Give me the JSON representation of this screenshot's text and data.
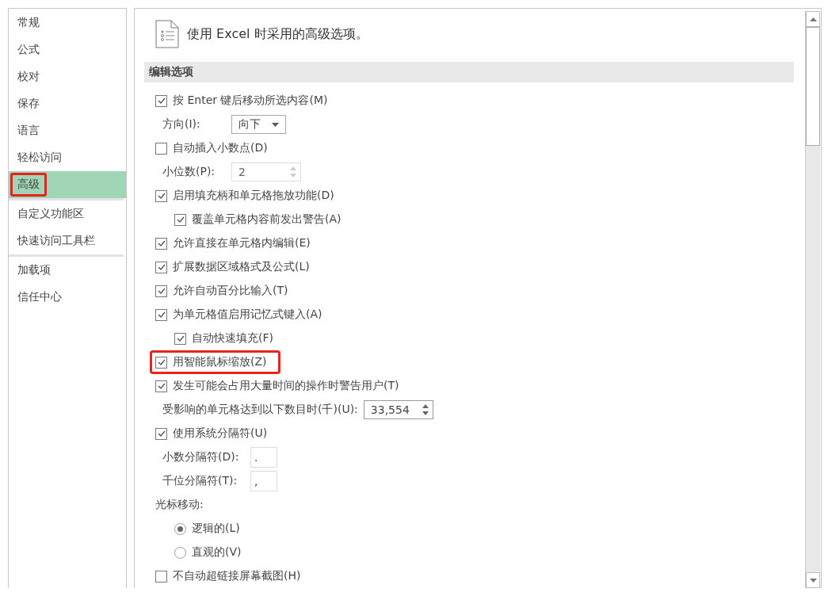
{
  "sidebar": {
    "groups": [
      [
        {
          "label": "常规",
          "selected": false,
          "highlighted": false
        },
        {
          "label": "公式",
          "selected": false,
          "highlighted": false
        },
        {
          "label": "校对",
          "selected": false,
          "highlighted": false
        },
        {
          "label": "保存",
          "selected": false,
          "highlighted": false
        },
        {
          "label": "语言",
          "selected": false,
          "highlighted": false
        },
        {
          "label": "轻松访问",
          "selected": false,
          "highlighted": false
        },
        {
          "label": "高级",
          "selected": true,
          "highlighted": true
        }
      ],
      [
        {
          "label": "自定义功能区",
          "selected": false,
          "highlighted": false
        },
        {
          "label": "快速访问工具栏",
          "selected": false,
          "highlighted": false
        }
      ],
      [
        {
          "label": "加载项",
          "selected": false,
          "highlighted": false
        },
        {
          "label": "信任中心",
          "selected": false,
          "highlighted": false
        }
      ]
    ]
  },
  "panel": {
    "title": "使用 Excel 时采用的高级选项。",
    "section": {
      "heading": "编辑选项",
      "items": [
        {
          "kind": "checkbox",
          "label": "按 Enter 键后移动所选内容(M)",
          "checked": true,
          "highlighted": false,
          "children": [
            {
              "kind": "select",
              "label": "方向(I):",
              "value": "向下"
            }
          ]
        },
        {
          "kind": "checkbox",
          "label": "自动插入小数点(D)",
          "checked": false,
          "highlighted": false,
          "children": [
            {
              "kind": "spin",
              "label": "小位数(P):",
              "value": "2",
              "disabled": true
            }
          ]
        },
        {
          "kind": "checkbox",
          "label": "启用填充柄和单元格拖放功能(D)",
          "checked": true,
          "highlighted": false,
          "children": [
            {
              "kind": "checkbox",
              "label": "覆盖单元格内容前发出警告(A)",
              "checked": true
            }
          ]
        },
        {
          "kind": "checkbox",
          "label": "允许直接在单元格内编辑(E)",
          "checked": true,
          "highlighted": false
        },
        {
          "kind": "checkbox",
          "label": "扩展数据区域格式及公式(L)",
          "checked": true,
          "highlighted": false
        },
        {
          "kind": "checkbox",
          "label": "允许自动百分比输入(T)",
          "checked": true,
          "highlighted": false
        },
        {
          "kind": "checkbox",
          "label": "为单元格值启用记忆式键入(A)",
          "checked": true,
          "highlighted": false,
          "children": [
            {
              "kind": "checkbox",
              "label": "自动快速填充(F)",
              "checked": true
            }
          ]
        },
        {
          "kind": "checkbox",
          "label": "用智能鼠标缩放(Z)",
          "checked": true,
          "highlighted": true
        },
        {
          "kind": "checkbox",
          "label": "发生可能会占用大量时间的操作时警告用户(T)",
          "checked": true,
          "highlighted": false,
          "children": [
            {
              "kind": "spin",
              "label": "受影响的单元格达到以下数目时(千)(U):",
              "value": "33,554",
              "disabled": false
            }
          ]
        },
        {
          "kind": "checkbox",
          "label": "使用系统分隔符(U)",
          "checked": true,
          "highlighted": false,
          "children": [
            {
              "kind": "text",
              "label": "小数分隔符(D):",
              "value": "."
            },
            {
              "kind": "text",
              "label": "千位分隔符(T):",
              "value": ","
            }
          ]
        },
        {
          "kind": "group",
          "label": "光标移动:",
          "children": [
            {
              "kind": "radio",
              "label": "逻辑的(L)",
              "selected": true
            },
            {
              "kind": "radio",
              "label": "直观的(V)",
              "selected": false
            }
          ]
        },
        {
          "kind": "checkbox",
          "label": "不自动超链接屏幕截图(H)",
          "checked": false,
          "highlighted": false
        }
      ]
    }
  }
}
